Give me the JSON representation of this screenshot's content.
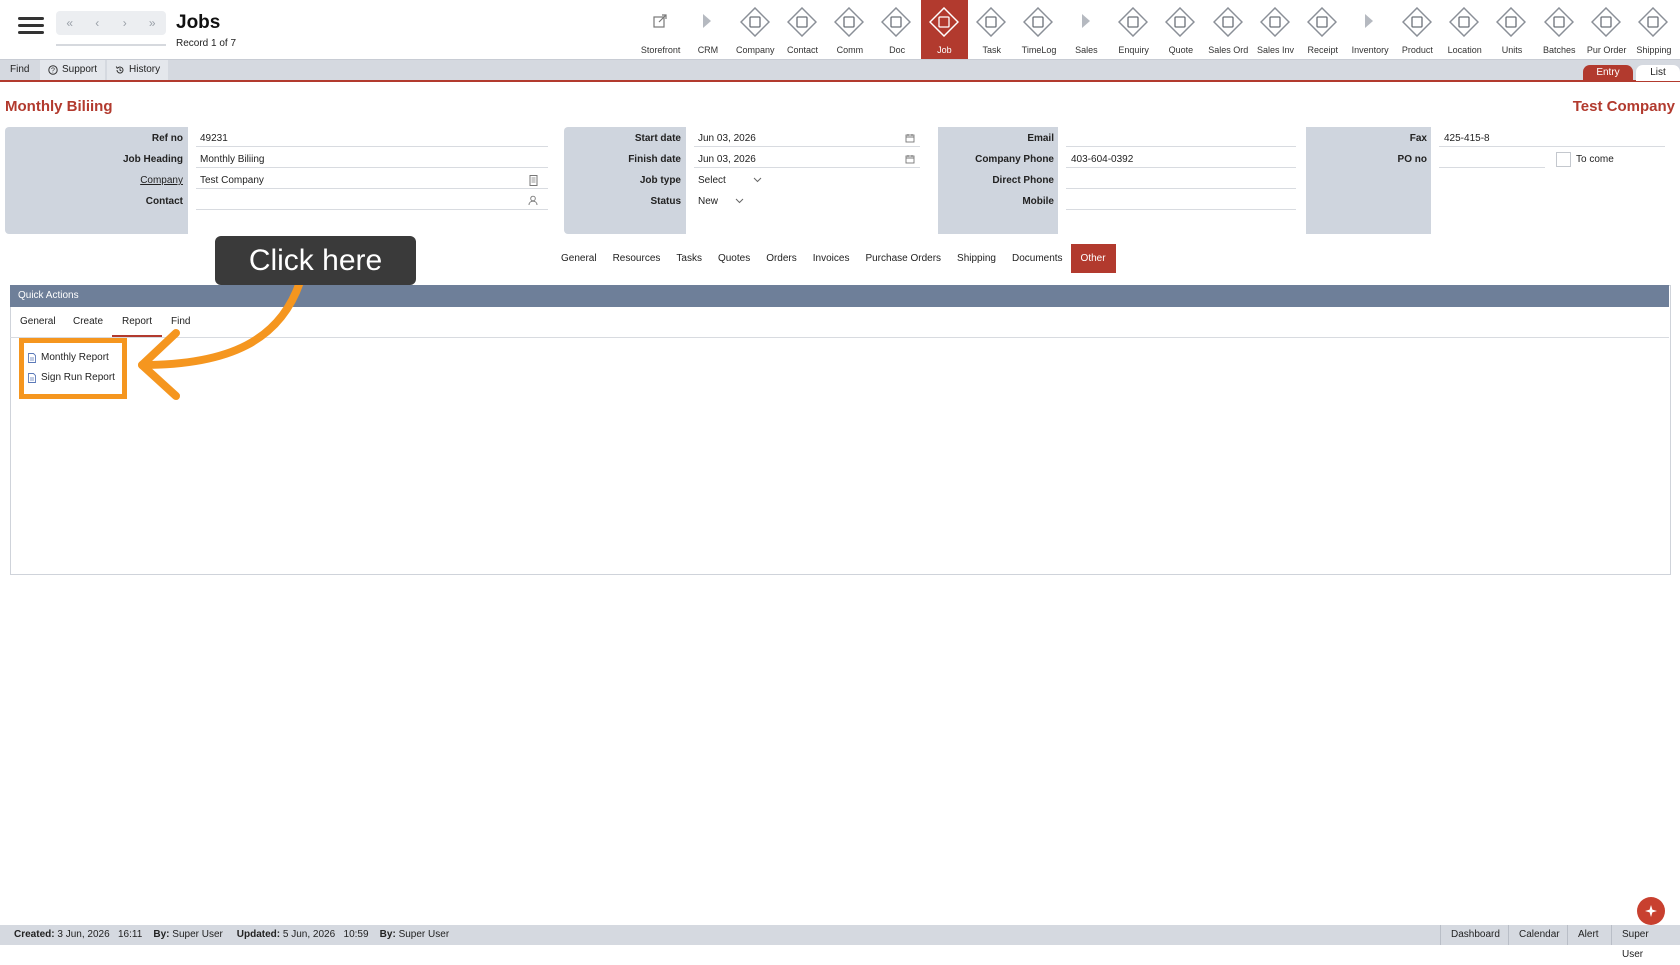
{
  "header": {
    "title": "Jobs",
    "record_count": "Record 1 of 7",
    "nav": [
      "«",
      "‹",
      "›",
      "»"
    ]
  },
  "modules": [
    {
      "label": "Storefront",
      "icon": "external-link-icon"
    },
    {
      "label": "CRM",
      "icon": "caret-right-icon"
    },
    {
      "label": "Company",
      "icon": "company-icon"
    },
    {
      "label": "Contact",
      "icon": "contact-icon"
    },
    {
      "label": "Comm",
      "icon": "comm-icon"
    },
    {
      "label": "Doc",
      "icon": "doc-icon"
    },
    {
      "label": "Job",
      "icon": "job-icon",
      "active": true
    },
    {
      "label": "Task",
      "icon": "task-icon"
    },
    {
      "label": "TimeLog",
      "icon": "clock-icon"
    },
    {
      "label": "Sales",
      "icon": "caret-right-icon"
    },
    {
      "label": "Enquiry",
      "icon": "enquiry-icon"
    },
    {
      "label": "Quote",
      "icon": "quote-icon"
    },
    {
      "label": "Sales Ord",
      "icon": "sales-order-icon"
    },
    {
      "label": "Sales Inv",
      "icon": "sales-invoice-icon"
    },
    {
      "label": "Receipt",
      "icon": "receipt-icon"
    },
    {
      "label": "Inventory",
      "icon": "caret-right-icon"
    },
    {
      "label": "Product",
      "icon": "product-icon"
    },
    {
      "label": "Location",
      "icon": "location-icon"
    },
    {
      "label": "Units",
      "icon": "units-icon"
    },
    {
      "label": "Batches",
      "icon": "batches-icon"
    },
    {
      "label": "Pur Order",
      "icon": "purchase-order-icon"
    },
    {
      "label": "Shipping",
      "icon": "shipping-icon"
    }
  ],
  "subbar": {
    "find": "Find",
    "support": "Support",
    "history": "History",
    "entry": "Entry",
    "list": "List"
  },
  "record": {
    "job_title": "Monthly Biliing",
    "company_title": "Test Company"
  },
  "form": {
    "ref_no_label": "Ref no",
    "ref_no": "49231",
    "job_heading_label": "Job Heading",
    "job_heading": "Monthly Biliing",
    "company_label": "Company",
    "company": "Test Company",
    "contact_label": "Contact",
    "contact": "",
    "start_date_label": "Start date",
    "start_date": "Jun 03, 2026",
    "finish_date_label": "Finish date",
    "finish_date": "Jun 03, 2026",
    "job_type_label": "Job type",
    "job_type": "Select",
    "status_label": "Status",
    "status": "New",
    "email_label": "Email",
    "email": "",
    "company_phone_label": "Company Phone",
    "company_phone": "403-604-0392",
    "direct_phone_label": "Direct Phone",
    "direct_phone": "",
    "mobile_label": "Mobile",
    "mobile": "",
    "fax_label": "Fax",
    "fax": "425-415-8",
    "po_no_label": "PO no",
    "po_no": "",
    "to_come_label": "To come"
  },
  "tabs": [
    "General",
    "Resources",
    "Tasks",
    "Quotes",
    "Orders",
    "Invoices",
    "Purchase Orders",
    "Shipping",
    "Documents",
    "Other"
  ],
  "active_tab": "Other",
  "quick_actions": {
    "title": "Quick Actions",
    "tabs": [
      "General",
      "Create",
      "Report",
      "Find"
    ],
    "active_tab": "Report",
    "reports": [
      "Monthly Report",
      "Sign Run Report"
    ]
  },
  "annotation": {
    "callout": "Click here",
    "color": "#f5961f"
  },
  "status_bar": {
    "created_label": "Created:",
    "created_date": "3 Jun, 2026",
    "created_time": "16:11",
    "created_by_label": "By:",
    "created_by": "Super User",
    "updated_label": "Updated:",
    "updated_date": "5 Jun, 2026",
    "updated_time": "10:59",
    "updated_by_label": "By:",
    "updated_by": "Super User",
    "links": [
      "Dashboard",
      "Calendar",
      "Alert",
      "Super User"
    ]
  },
  "colors": {
    "accent": "#b23a2e",
    "panel": "#cfd5de",
    "qa_header": "#6e7f99"
  }
}
